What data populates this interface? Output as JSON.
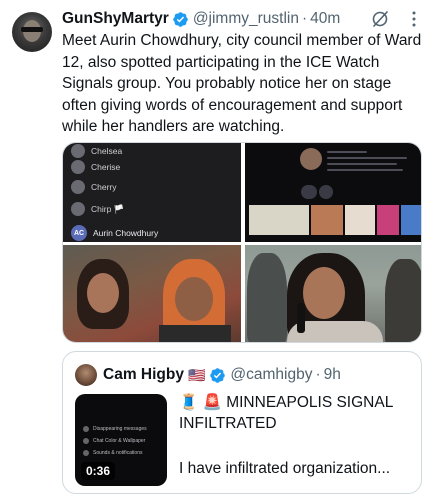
{
  "tweet": {
    "author_name": "GunShyMartyr",
    "handle": "@jimmy_rustlin",
    "separator": "·",
    "time": "40m",
    "text": "Meet Aurin Chowdhury, city council member of Ward 12, also spotted participating in the ICE Watch Signals group. You probably notice her on stage often giving words of encouragement and support while her handlers are watching."
  },
  "media": {
    "chat_list": [
      "Chelsea",
      "Cherise",
      "Cherry",
      "Chirp 🏳️"
    ],
    "chat_badge_initials": "AC",
    "chat_selected_name": "Aurin Chowdhury"
  },
  "quote": {
    "author_name": "Cam Higby",
    "flag": "🇺🇸",
    "handle": "@camhigby",
    "separator": "·",
    "time": "9h",
    "title": "🧵 🚨 MINNEAPOLIS SIGNAL INFILTRATED",
    "body": "I have infiltrated organization...",
    "video_duration": "0:36",
    "video_rows": [
      "Disappearing messages",
      "Chat Color & Wallpaper",
      "Sounds & notifications"
    ]
  },
  "colors": {
    "verified": "#1d9bf0",
    "text": "#0f1419",
    "secondary": "#536471",
    "border": "#cfd9de"
  }
}
